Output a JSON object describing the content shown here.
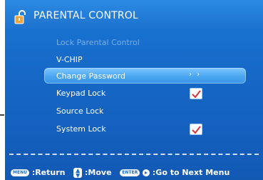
{
  "title": "PARENTAL CONTROL",
  "menu": {
    "items": [
      {
        "label": "Lock Parental Control"
      },
      {
        "label": "V-CHIP"
      },
      {
        "label": "Change Password",
        "indicator": "› ›"
      },
      {
        "label": "Keypad Lock",
        "checked": true
      },
      {
        "label": "Source Lock"
      },
      {
        "label": "System Lock",
        "checked": true
      }
    ]
  },
  "footer": {
    "menu_key": "MENU",
    "return_label": ":Return",
    "move_label": ":Move",
    "enter_key": "ENTER",
    "next_label": ":Go to Next Menu"
  },
  "colors": {
    "panel": "#1668c7",
    "highlight": "#4aa6f1",
    "disabled_text": "#79aee6",
    "check": "#d9313b"
  },
  "icons": {
    "header": "padlock-icon",
    "checkbox": "checkmark-icon"
  }
}
